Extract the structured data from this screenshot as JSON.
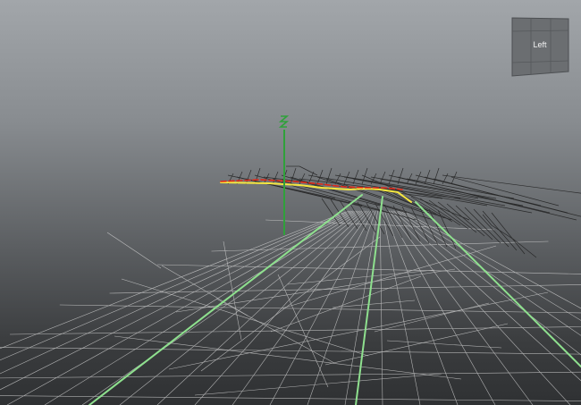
{
  "viewport": {
    "background_top": "#a2a6aa",
    "background_bottom": "#2f3133",
    "wireframe_color": "#dcdcdc",
    "dark_wire_color": "#1e1e1e",
    "selection_curve_color": "#8ee08e",
    "highlight_curve_color": "#f5e640",
    "red_curve_color": "#e02a1a",
    "axis_color": "#2fa13a"
  },
  "view_cube": {
    "face_label": "Left",
    "icon": "view-cube-icon"
  }
}
